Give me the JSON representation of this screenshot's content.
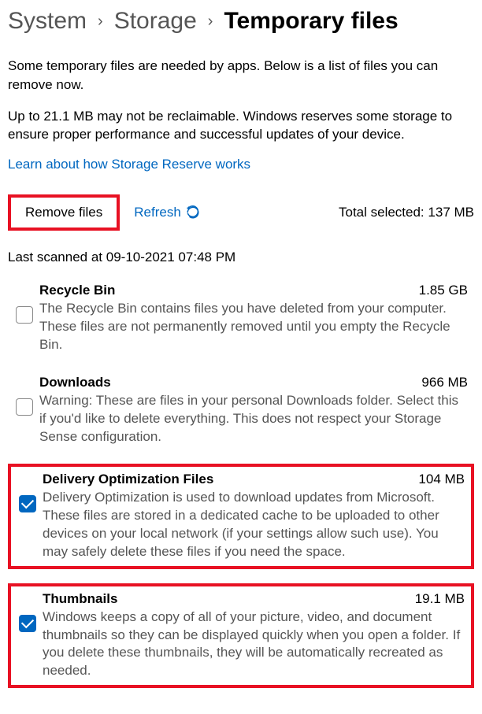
{
  "breadcrumb": {
    "system": "System",
    "storage": "Storage",
    "current": "Temporary files"
  },
  "intro": {
    "line1": "Some temporary files are needed by apps. Below is a list of files you can remove now.",
    "line2": "Up to 21.1 MB may not be reclaimable. Windows reserves some storage to ensure proper performance and successful updates of your device.",
    "link": "Learn about how Storage Reserve works"
  },
  "actions": {
    "remove": "Remove files",
    "refresh": "Refresh",
    "total_label": "Total selected:",
    "total_value": "137 MB"
  },
  "last_scanned": "Last scanned at 09-10-2021 07:48 PM",
  "items": [
    {
      "title": "Recycle Bin",
      "size": "1.85 GB",
      "description": "The Recycle Bin contains files you have deleted from your computer. These files are not permanently removed until you empty the Recycle Bin.",
      "checked": false,
      "highlighted": false
    },
    {
      "title": "Downloads",
      "size": "966 MB",
      "description": "Warning: These are files in your personal Downloads folder. Select this if you'd like to delete everything. This does not respect your Storage Sense configuration.",
      "checked": false,
      "highlighted": false
    },
    {
      "title": "Delivery Optimization Files",
      "size": "104 MB",
      "description": "Delivery Optimization is used to download updates from Microsoft. These files are stored in a dedicated cache to be uploaded to other devices on your local network (if your settings allow such use). You may safely delete these files if you need the space.",
      "checked": true,
      "highlighted": true
    },
    {
      "title": "Thumbnails",
      "size": "19.1 MB",
      "description": "Windows keeps a copy of all of your picture, video, and document thumbnails so they can be displayed quickly when you open a folder. If you delete these thumbnails, they will be automatically recreated as needed.",
      "checked": true,
      "highlighted": true
    }
  ]
}
